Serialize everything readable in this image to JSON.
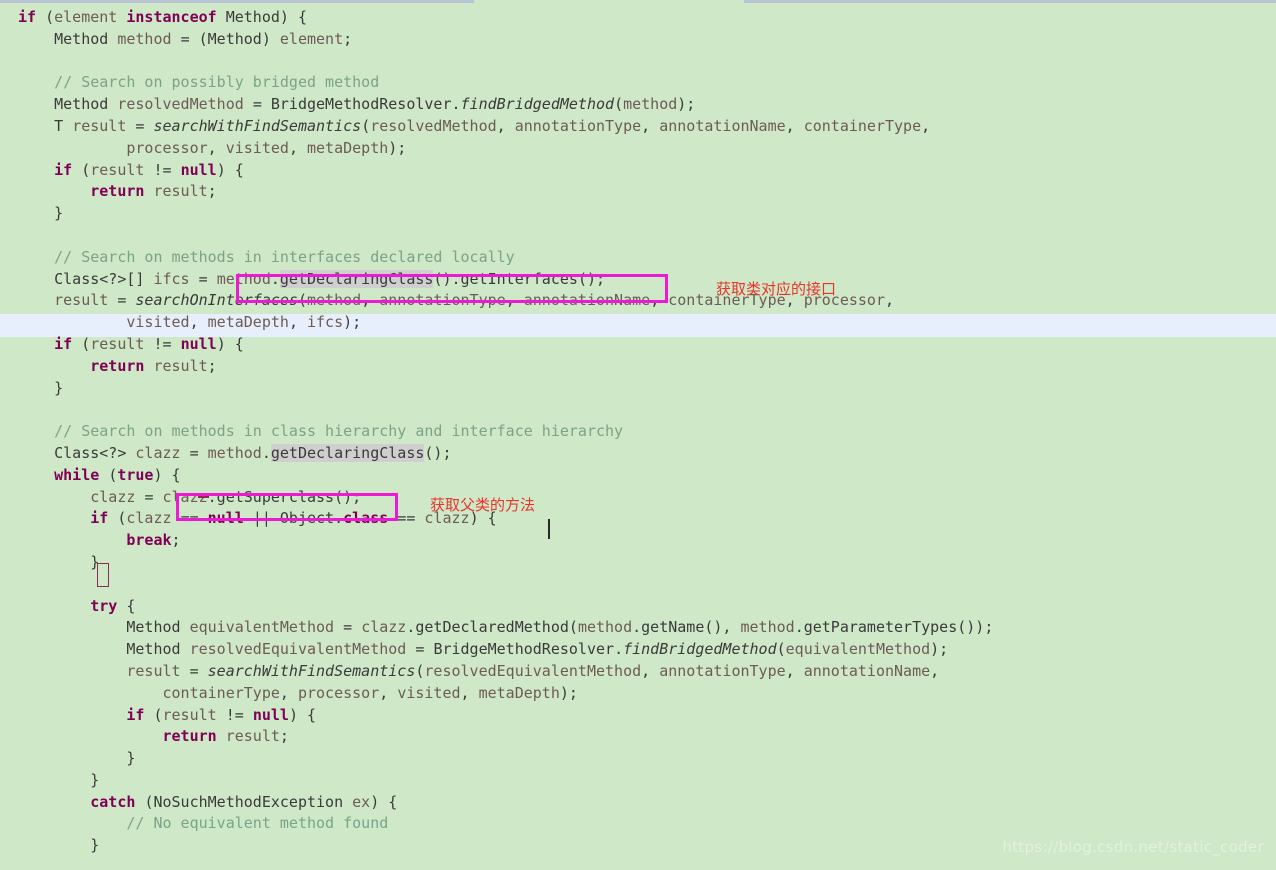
{
  "editor": {
    "language": "java",
    "background_color": "#cee8c8",
    "current_line_highlight_color": "#e6effb",
    "keyword_color": "#7f0055",
    "comment_color": "#7aa487",
    "identifier_color": "#6e5b55",
    "occurrence_highlight_color": "#cfcfcf",
    "annotation_box_color": "#ef18d4",
    "annotation_text_color": "#e8342a"
  },
  "scrollbar": {
    "orientation": "horizontal",
    "position": "top",
    "thumb_color": "#cee8c8",
    "track_color": "#b8c4d4"
  },
  "code": {
    "lines": [
      "if (element instanceof Method) {",
      "    Method method = (Method) element;",
      "",
      "    // Search on possibly bridged method",
      "    Method resolvedMethod = BridgeMethodResolver.findBridgedMethod(method);",
      "    T result = searchWithFindSemantics(resolvedMethod, annotationType, annotationName, containerType,",
      "            processor, visited, metaDepth);",
      "    if (result != null) {",
      "        return result;",
      "    }",
      "",
      "    // Search on methods in interfaces declared locally",
      "    Class<?>[] ifcs = method.getDeclaringClass().getInterfaces();",
      "    result = searchOnInterfaces(method, annotationType, annotationName, containerType, processor,",
      "            visited, metaDepth, ifcs);",
      "    if (result != null) {",
      "        return result;",
      "    }",
      "",
      "    // Search on methods in class hierarchy and interface hierarchy",
      "    Class<?> clazz = method.getDeclaringClass();",
      "    while (true) {",
      "        clazz = clazz.getSuperclass();",
      "        if (clazz == null || Object.class == clazz) {",
      "            break;",
      "        }",
      "",
      "        try {",
      "            Method equivalentMethod = clazz.getDeclaredMethod(method.getName(), method.getParameterTypes());",
      "            Method resolvedEquivalentMethod = BridgeMethodResolver.findBridgedMethod(equivalentMethod);",
      "            result = searchWithFindSemantics(resolvedEquivalentMethod, annotationType, annotationName,",
      "                containerType, processor, visited, metaDepth);",
      "            if (result != null) {",
      "                return result;",
      "            }",
      "        }",
      "        catch (NoSuchMethodException ex) {",
      "            // No equivalent method found",
      "        }"
    ],
    "current_line_number": 24,
    "current_line_text": "        if (clazz == null || Object.class == clazz) {"
  },
  "annotations": [
    {
      "id": "interfaces",
      "boxed_code": "method.getDeclaringClass().getInterfaces();",
      "note": "获取类对应的接口"
    },
    {
      "id": "superclass",
      "boxed_code": "clazz.getSuperclass();",
      "note": "获取父类的方法"
    }
  ],
  "watermark": {
    "text": "https://blog.csdn.net/static_coder"
  }
}
